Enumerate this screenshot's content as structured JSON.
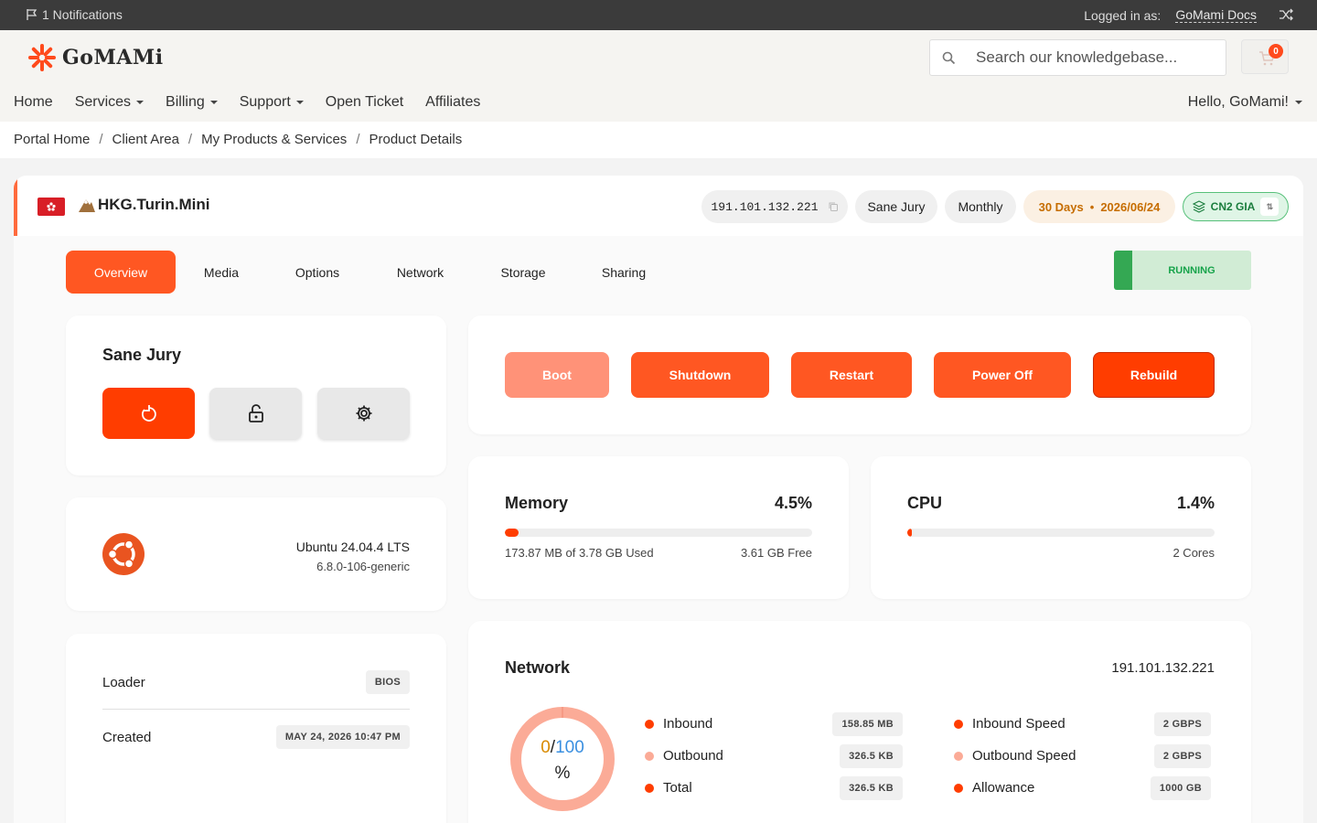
{
  "topbar": {
    "notifications": "1 Notifications",
    "logged_in_label": "Logged in as:",
    "account": "GoMami Docs"
  },
  "header": {
    "logo_text": "GoMAMi",
    "search_placeholder": "Search our knowledgebase...",
    "cart_count": "0",
    "nav": [
      "Home",
      "Services",
      "Billing",
      "Support",
      "Open Ticket",
      "Affiliates"
    ],
    "hello": "Hello, GoMami!"
  },
  "breadcrumb": [
    "Portal Home",
    "Client Area",
    "My Products & Services",
    "Product Details"
  ],
  "product": {
    "name": "HKG.Turin.Mini",
    "ip": "191.101.132.221",
    "label": "Sane Jury",
    "cycle": "Monthly",
    "days": "30 Days",
    "due": "2026/06/24",
    "route": "CN2 GIA"
  },
  "tabs": [
    "Overview",
    "Media",
    "Options",
    "Network",
    "Storage",
    "Sharing"
  ],
  "status": "RUNNING",
  "vm": {
    "name": "Sane Jury"
  },
  "actions": {
    "boot": "Boot",
    "shutdown": "Shutdown",
    "restart": "Restart",
    "poweroff": "Power Off",
    "rebuild": "Rebuild"
  },
  "os": {
    "name": "Ubuntu 24.04.4 LTS",
    "kernel": "6.8.0-106-generic"
  },
  "memory": {
    "title": "Memory",
    "percent": "4.5%",
    "fill": 4.5,
    "used": "173.87 MB of 3.78 GB Used",
    "free": "3.61 GB Free"
  },
  "cpu": {
    "title": "CPU",
    "percent": "1.4%",
    "fill": 1.4,
    "cores": "2 Cores"
  },
  "info": {
    "loader_label": "Loader",
    "loader_value": "BIOS",
    "created_label": "Created",
    "created_value": "MAY 24, 2026 10:47 PM"
  },
  "network": {
    "title": "Network",
    "ip": "191.101.132.221",
    "gauge_used": "0",
    "gauge_sep": "/",
    "gauge_total": "100",
    "gauge_unit": "%",
    "rows_left": [
      {
        "label": "Inbound",
        "value": "158.85 MB"
      },
      {
        "label": "Outbound",
        "value": "326.5 KB"
      },
      {
        "label": "Total",
        "value": "326.5 KB"
      }
    ],
    "rows_right": [
      {
        "label": "Inbound Speed",
        "value": "2 GBPS"
      },
      {
        "label": "Outbound Speed",
        "value": "2 GBPS"
      },
      {
        "label": "Allowance",
        "value": "1000 GB"
      }
    ]
  },
  "colors": {
    "accent": "#ff5722",
    "danger": "#ff3d00",
    "running": "#16a34a",
    "boot": "#ff9278"
  }
}
